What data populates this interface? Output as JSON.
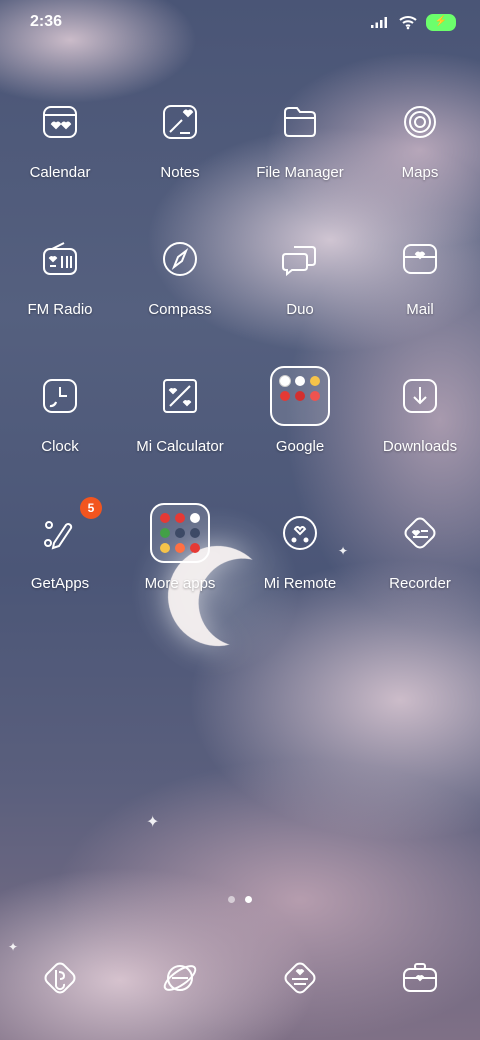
{
  "status_bar": {
    "time": "2:36",
    "battery_glyph": "⚡"
  },
  "apps": [
    {
      "label": "Calendar",
      "icon": "calendar-icon"
    },
    {
      "label": "Notes",
      "icon": "notes-icon"
    },
    {
      "label": "File Manager",
      "icon": "folder-icon"
    },
    {
      "label": "Maps",
      "icon": "maps-icon"
    },
    {
      "label": "FM Radio",
      "icon": "radio-icon"
    },
    {
      "label": "Compass",
      "icon": "compass-icon"
    },
    {
      "label": "Duo",
      "icon": "chat-icon"
    },
    {
      "label": "Mail",
      "icon": "mail-icon"
    },
    {
      "label": "Clock",
      "icon": "clock-icon"
    },
    {
      "label": "Mi Calculator",
      "icon": "calculator-icon"
    },
    {
      "label": "Google",
      "icon": "folder-group"
    },
    {
      "label": "Downloads",
      "icon": "download-icon"
    },
    {
      "label": "GetApps",
      "icon": "getapps-icon",
      "badge": "5"
    },
    {
      "label": "More apps",
      "icon": "folder-group"
    },
    {
      "label": "Mi Remote",
      "icon": "remote-icon"
    },
    {
      "label": "Recorder",
      "icon": "recorder-icon"
    }
  ],
  "dock": [
    {
      "icon": "phone-icon"
    },
    {
      "icon": "browser-icon"
    },
    {
      "icon": "messages-icon"
    },
    {
      "icon": "camera-icon"
    }
  ],
  "colors": {
    "badge": "#f2551f",
    "battery": "#6cff6c"
  }
}
